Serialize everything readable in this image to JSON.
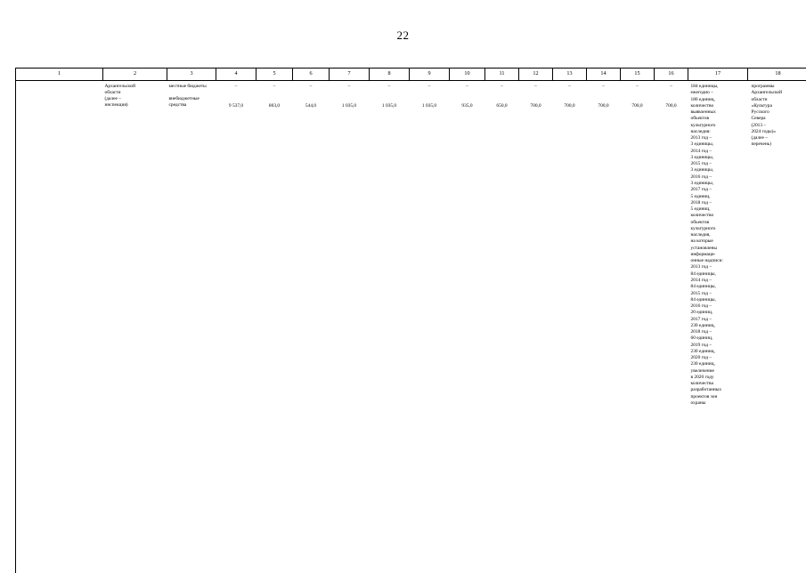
{
  "document": {
    "page_number": "22"
  },
  "table": {
    "column_numbers": [
      "1",
      "2",
      "3",
      "4",
      "5",
      "6",
      "7",
      "8",
      "9",
      "10",
      "11",
      "12",
      "13",
      "14",
      "15",
      "16",
      "17",
      "18"
    ],
    "row": {
      "col1": "",
      "col2": "Архангельской\nобласти\n(далее –\nинспекция)",
      "col3_line1": "местные\nбюджеты",
      "col3_line2": "внебюджетные\nсредства",
      "dash": "–",
      "values": {
        "col4": "9 537,0",
        "col5": "803,0",
        "col6": "544,0",
        "col7": "1 035,0",
        "col8": "1 035,0",
        "col9": "1 035,0",
        "col10": "935,0",
        "col11": "650,0",
        "col12": "700,0",
        "col13": "700,0",
        "col14": "700,0",
        "col15": "700,0",
        "col16": "700,0"
      },
      "col17": "184 единицы,\nежегодно –\n180 единиц,\nколичество\nвыявленных\nобъектов\nкультурного\nнаследия:\n2013 год –\n3 единицы,\n2014 год –\n3 единицы,\n2015 год –\n3 единицы,\n2016 год –\n3 единицы,\n2017 год –\n5 единиц,\n2018 год –\n5 единиц,\nколичество\nобъектов\nкультурного\nнаследия,\nна которые\nустановлены\nинформаци-\nонные надписи:\n2013 год –\n84 единицы,\n2014 год –\n84 единицы,\n2015 год –\n84 единицы,\n2016 год –\n20 единиц,\n2017 год –\n230 единиц,\n2018 год –\n60 единиц,\n2019 год –\n230 единиц,\n2020 год –\n230 единиц,\nувеличение\nв 2020 году\nколичества\nразработанных\nпроектов зон\nохраны",
      "col18": "программы\nАрхангельской\nобласти\n«Культура\nРусского\nСевера\n(2013 –\n2024 годы)»\n(далее –\nперечень)"
    }
  }
}
